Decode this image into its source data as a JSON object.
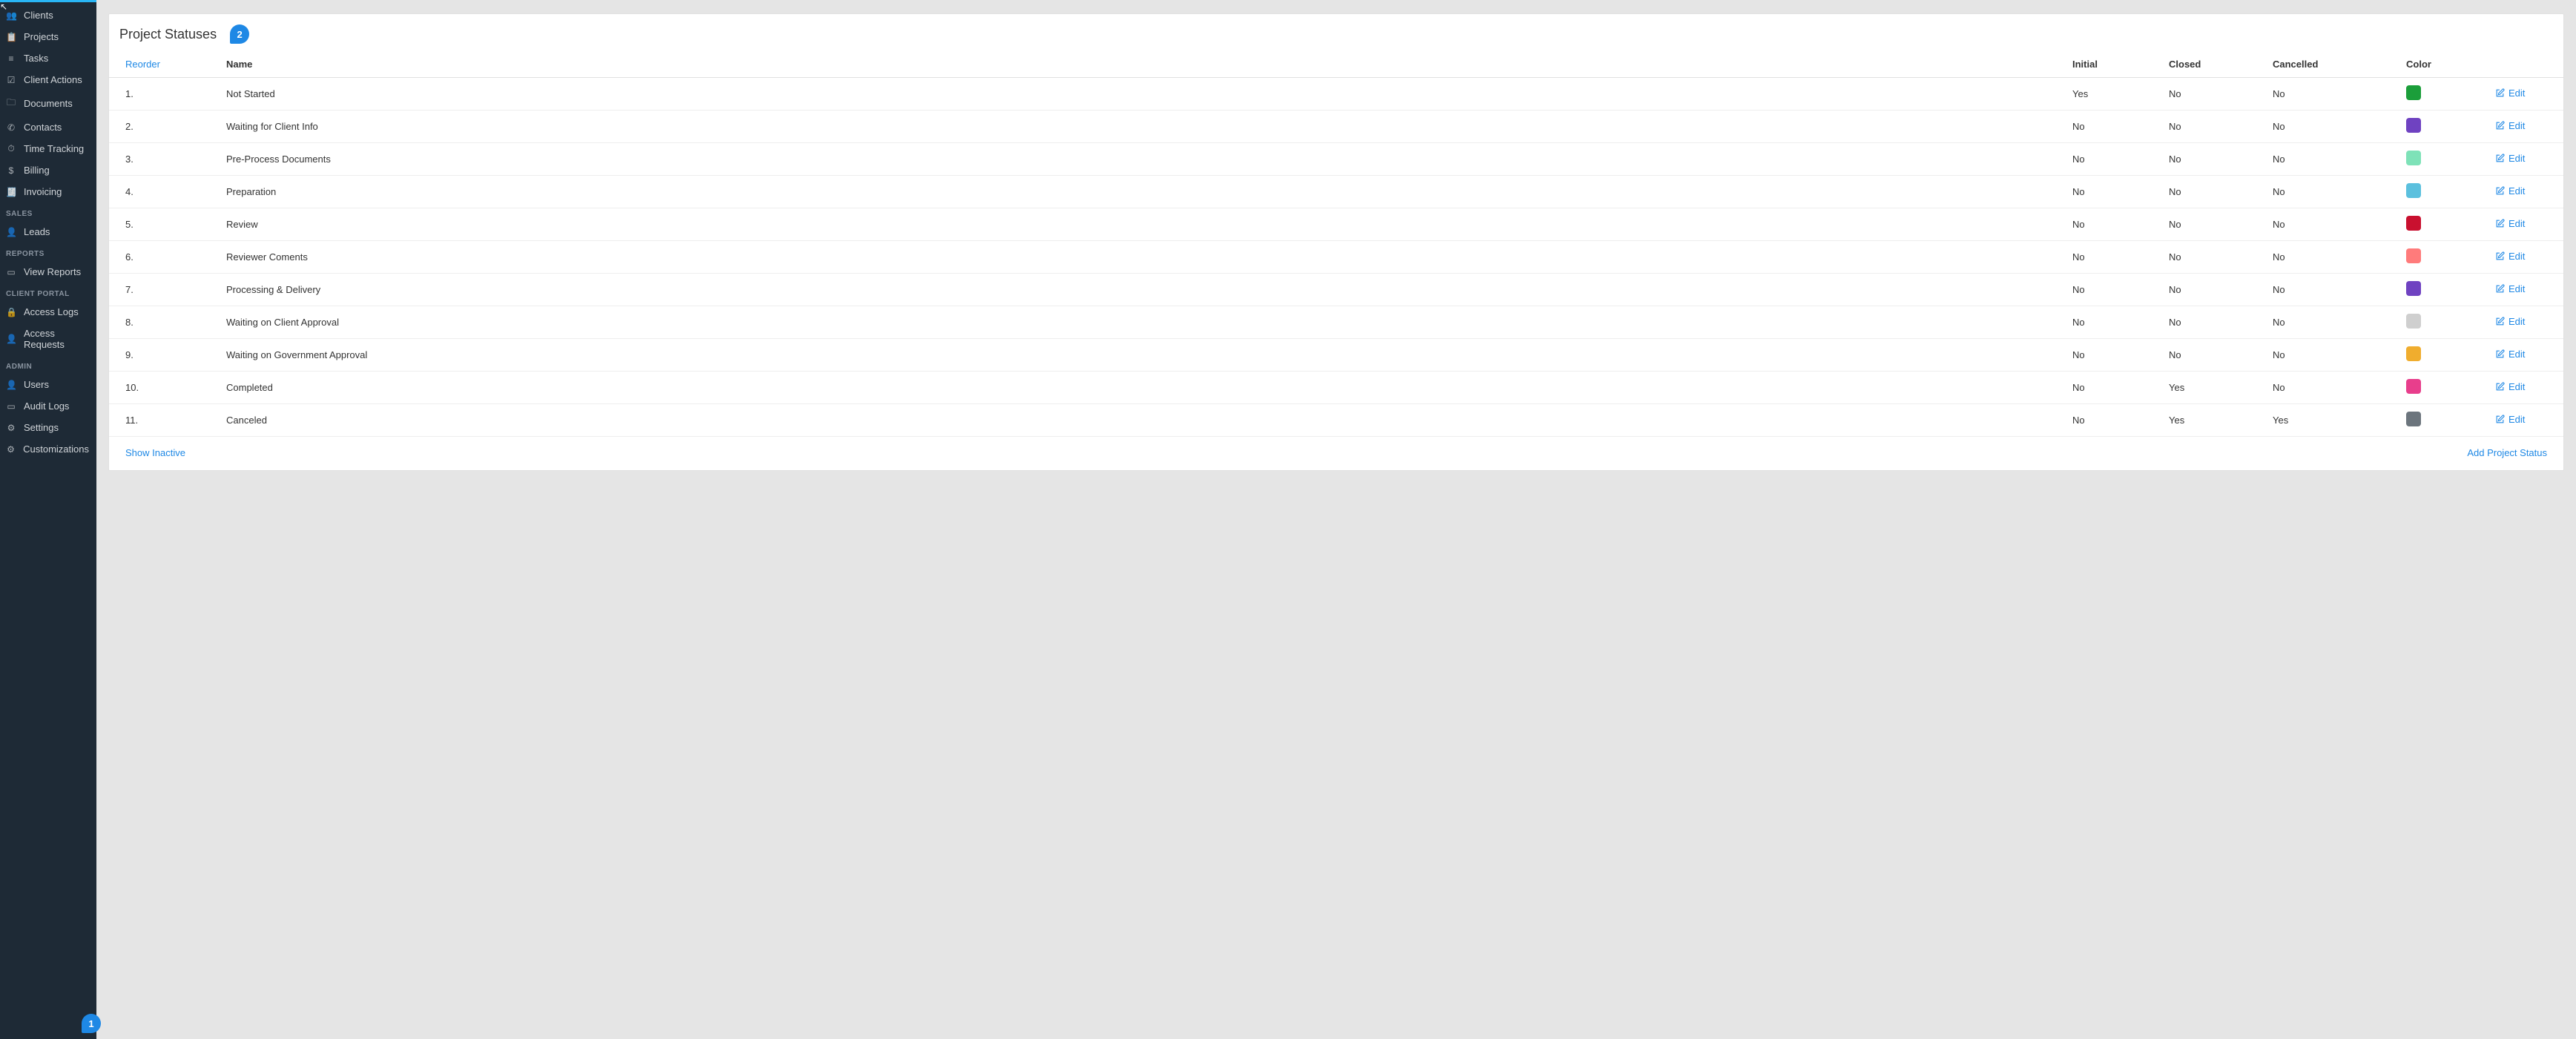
{
  "sidebar": {
    "groups": [
      {
        "items": [
          {
            "icon": "👥",
            "label": "Clients",
            "name": "nav-clients"
          },
          {
            "icon": "📋",
            "label": "Projects",
            "name": "nav-projects"
          },
          {
            "icon": "≡",
            "label": "Tasks",
            "name": "nav-tasks"
          },
          {
            "icon": "☑",
            "label": "Client Actions",
            "name": "nav-client-actions"
          },
          {
            "icon": "🗀",
            "label": "Documents",
            "name": "nav-documents"
          },
          {
            "icon": "✆",
            "label": "Contacts",
            "name": "nav-contacts"
          },
          {
            "icon": "⏱",
            "label": "Time Tracking",
            "name": "nav-time-tracking"
          },
          {
            "icon": "$",
            "label": "Billing",
            "name": "nav-billing"
          },
          {
            "icon": "🧾",
            "label": "Invoicing",
            "name": "nav-invoicing"
          }
        ]
      },
      {
        "header": "SALES",
        "items": [
          {
            "icon": "👤",
            "label": "Leads",
            "name": "nav-leads"
          }
        ]
      },
      {
        "header": "REPORTS",
        "items": [
          {
            "icon": "▭",
            "label": "View Reports",
            "name": "nav-view-reports"
          }
        ]
      },
      {
        "header": "CLIENT PORTAL",
        "items": [
          {
            "icon": "🔒",
            "label": "Access Logs",
            "name": "nav-access-logs"
          },
          {
            "icon": "👤",
            "label": "Access Requests",
            "name": "nav-access-requests"
          }
        ]
      },
      {
        "header": "ADMIN",
        "items": [
          {
            "icon": "👤",
            "label": "Users",
            "name": "nav-users"
          },
          {
            "icon": "▭",
            "label": "Audit Logs",
            "name": "nav-audit-logs"
          },
          {
            "icon": "⚙",
            "label": "Settings",
            "name": "nav-settings"
          },
          {
            "icon": "⚙",
            "label": "Customizations",
            "name": "nav-customizations"
          }
        ]
      }
    ]
  },
  "callouts": {
    "badge1": "1",
    "badge2": "2"
  },
  "page": {
    "title": "Project Statuses",
    "columns": {
      "reorder": "Reorder",
      "name": "Name",
      "initial": "Initial",
      "closed": "Closed",
      "cancelled": "Cancelled",
      "color": "Color"
    },
    "rows": [
      {
        "order": "1.",
        "name": "Not Started",
        "initial": "Yes",
        "closed": "No",
        "cancelled": "No",
        "color": "#1b9e3a"
      },
      {
        "order": "2.",
        "name": "Waiting for Client Info",
        "initial": "No",
        "closed": "No",
        "cancelled": "No",
        "color": "#6f42c1"
      },
      {
        "order": "3.",
        "name": "Pre-Process Documents",
        "initial": "No",
        "closed": "No",
        "cancelled": "No",
        "color": "#7ee2b8"
      },
      {
        "order": "4.",
        "name": "Preparation",
        "initial": "No",
        "closed": "No",
        "cancelled": "No",
        "color": "#5bc0de"
      },
      {
        "order": "5.",
        "name": "Review",
        "initial": "No",
        "closed": "No",
        "cancelled": "No",
        "color": "#c9102f"
      },
      {
        "order": "6.",
        "name": "Reviewer Coments",
        "initial": "No",
        "closed": "No",
        "cancelled": "No",
        "color": "#ff7b7b"
      },
      {
        "order": "7.",
        "name": "Processing & Delivery",
        "initial": "No",
        "closed": "No",
        "cancelled": "No",
        "color": "#6f42c1"
      },
      {
        "order": "8.",
        "name": "Waiting on Client Approval",
        "initial": "No",
        "closed": "No",
        "cancelled": "No",
        "color": "#cfcfcf"
      },
      {
        "order": "9.",
        "name": "Waiting on Government Approval",
        "initial": "No",
        "closed": "No",
        "cancelled": "No",
        "color": "#f0ad2e"
      },
      {
        "order": "10.",
        "name": "Completed",
        "initial": "No",
        "closed": "Yes",
        "cancelled": "No",
        "color": "#e83e8c"
      },
      {
        "order": "11.",
        "name": "Canceled",
        "initial": "No",
        "closed": "Yes",
        "cancelled": "Yes",
        "color": "#6c757d"
      }
    ],
    "edit_label": "Edit",
    "footer": {
      "show_inactive": "Show Inactive",
      "add_status": "Add Project Status"
    }
  }
}
